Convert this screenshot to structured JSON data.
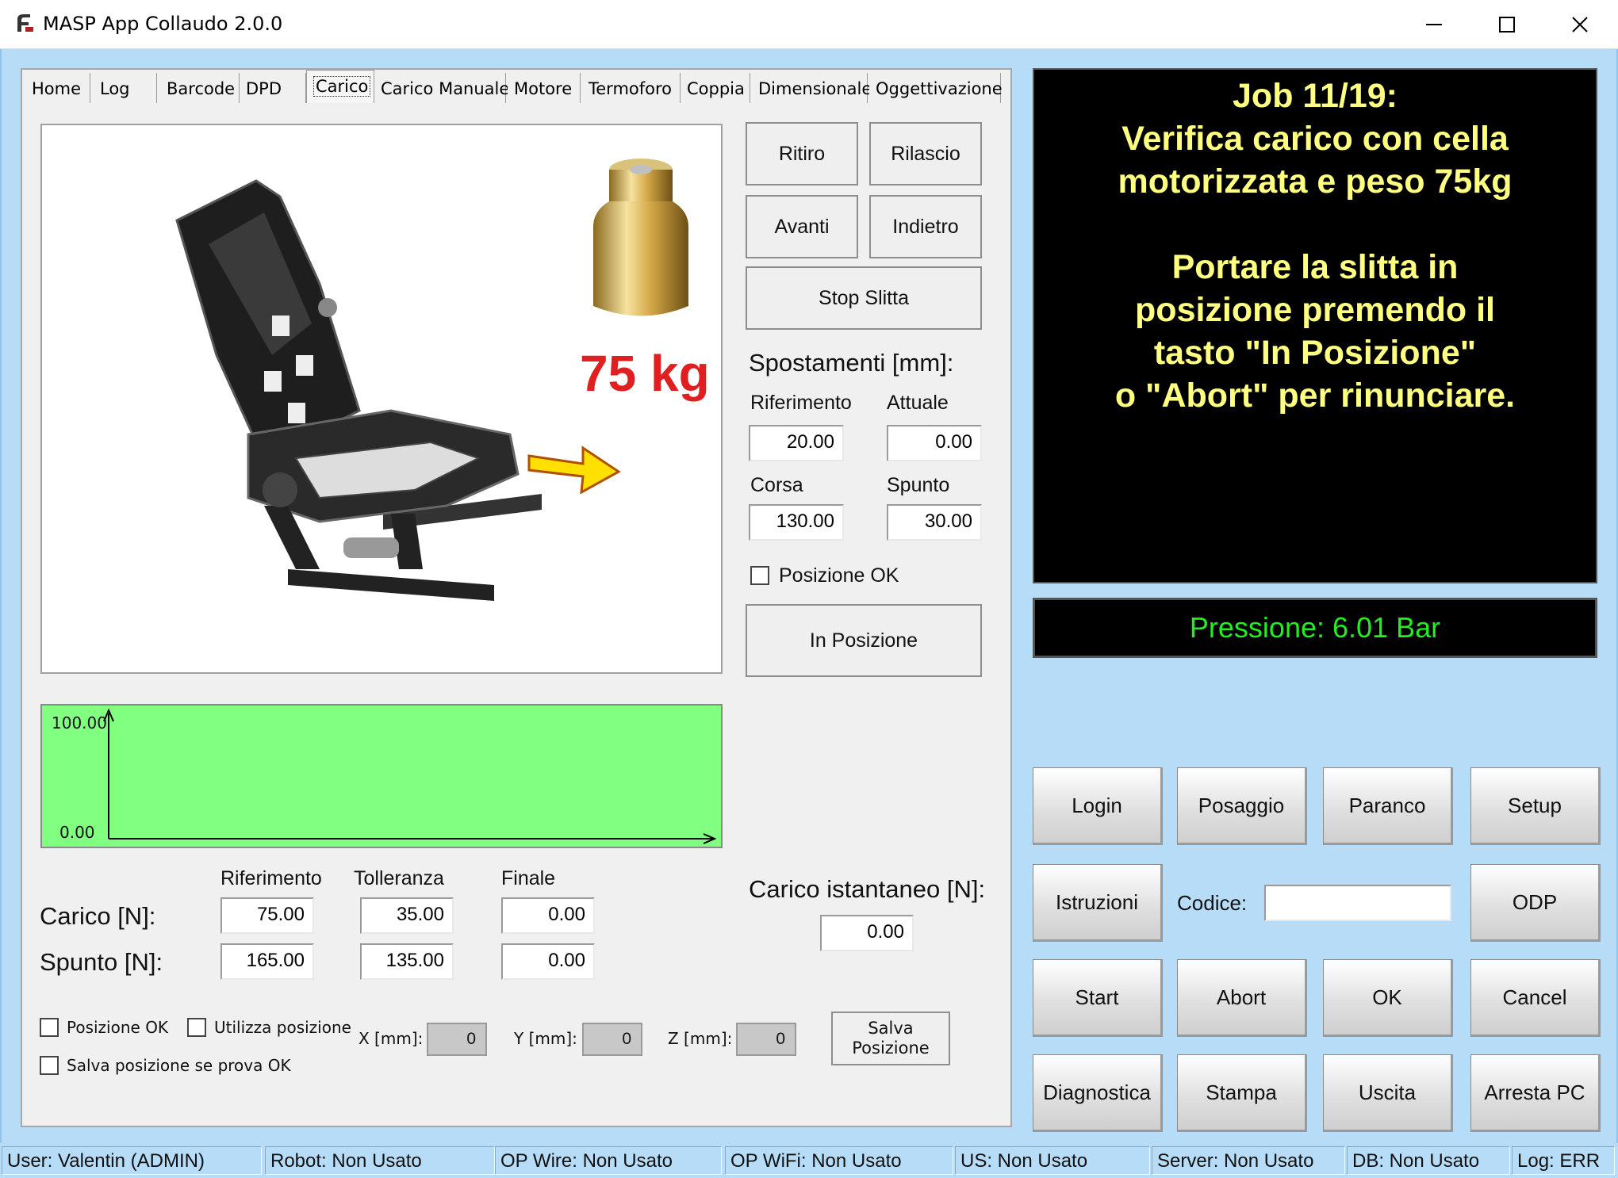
{
  "window": {
    "title": "MASP App Collaudo 2.0.0",
    "minimize_glyph": "—",
    "maximize_glyph": "☐",
    "close_glyph": "✕"
  },
  "tabs": [
    "Home",
    "Log",
    "Barcode",
    "DPD",
    "Carico",
    "Carico Manuale",
    "Motore",
    "Termoforo",
    "Coppia",
    "Dimensionale",
    "Oggettivazione"
  ],
  "active_tab": "Carico",
  "picture": {
    "weight_label": "75 kg"
  },
  "motion_buttons": {
    "ritiro": "Ritiro",
    "rilascio": "Rilascio",
    "avanti": "Avanti",
    "indietro": "Indietro",
    "stop_slitta": "Stop Slitta",
    "in_posizione": "In Posizione"
  },
  "spostamenti": {
    "title": "Spostamenti [mm]:",
    "riferimento_label": "Riferimento",
    "riferimento_value": "20.00",
    "attuale_label": "Attuale",
    "attuale_value": "0.00",
    "corsa_label": "Corsa",
    "corsa_value": "130.00",
    "spunto_label": "Spunto",
    "spunto_value": "30.00",
    "posizione_ok": "Posizione OK"
  },
  "graph": {
    "y_max": "100.00",
    "y_min": "0.00"
  },
  "load_table": {
    "headers": [
      "Riferimento",
      "Tolleranza",
      "Finale"
    ],
    "rows": [
      {
        "label": "Carico [N]:",
        "values": [
          "75.00",
          "35.00",
          "0.00"
        ]
      },
      {
        "label": "Spunto [N]:",
        "values": [
          "165.00",
          "135.00",
          "0.00"
        ]
      }
    ]
  },
  "carico_istantaneo": {
    "label": "Carico istantaneo [N]:",
    "value": "0.00"
  },
  "position_options": {
    "posizione_ok": "Posizione OK",
    "utilizza_posizione": "Utilizza posizione",
    "salva_se_ok": "Salva posizione se prova OK",
    "x_label": "X [mm]:",
    "x_value": "0",
    "y_label": "Y [mm]:",
    "y_value": "0",
    "z_label": "Z [mm]:",
    "z_value": "0",
    "salva_line1": "Salva",
    "salva_line2": "Posizione"
  },
  "instructions": {
    "lines": [
      "Job 11/19:",
      "Verifica carico con cella",
      "motorizzata e peso 75kg",
      "",
      "Portare la slitta in",
      "posizione premendo il",
      "tasto \"In Posizione\"",
      "o \"Abort\" per rinunciare."
    ]
  },
  "pressure": "Pressione: 6.01 Bar",
  "control_buttons": {
    "login": "Login",
    "posaggio": "Posaggio",
    "paranco": "Paranco",
    "setup": "Setup",
    "istruzioni": "Istruzioni",
    "codice_label": "Codice:",
    "codice_value": "",
    "odp": "ODP",
    "start": "Start",
    "abort": "Abort",
    "ok": "OK",
    "cancel": "Cancel",
    "diagnostica": "Diagnostica",
    "stampa": "Stampa",
    "uscita": "Uscita",
    "arresta": "Arresta PC"
  },
  "status": [
    "User: Valentin (ADMIN)",
    "Robot: Non Usato",
    "OP Wire: Non Usato",
    "OP WiFi: Non Usato",
    "US: Non Usato",
    "Server: Non Usato",
    "DB: Non Usato",
    "Log: ERR"
  ],
  "colors": {
    "accent_background": "#b7dcf7",
    "graph_fill": "#80ff80",
    "instruction_text": "#ffff80",
    "pressure_text": "#22ee22",
    "weight_text": "#e02020"
  }
}
